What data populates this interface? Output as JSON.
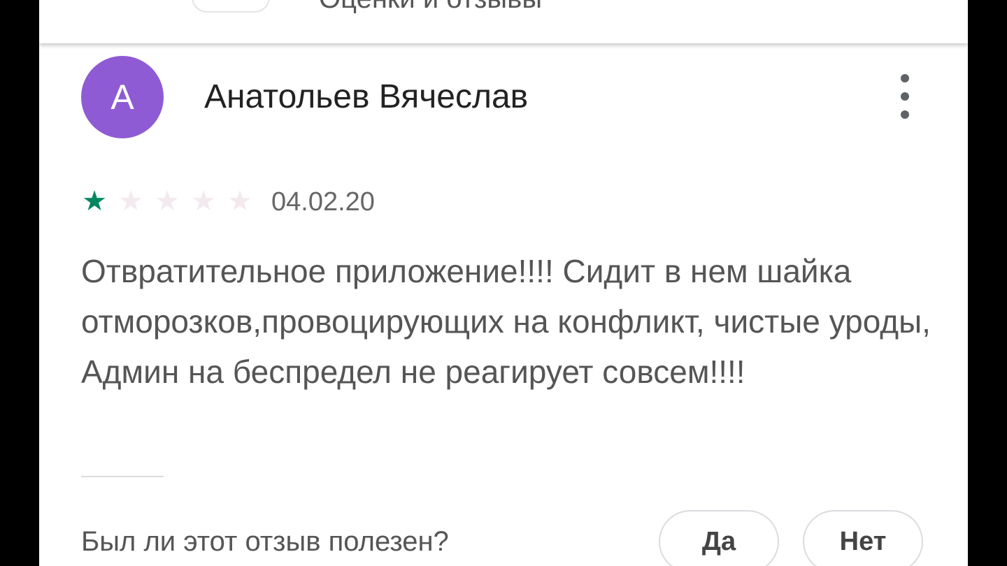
{
  "appbar": {
    "title": "Оценки и отзывы"
  },
  "review": {
    "avatar_letter": "A",
    "avatar_color": "#8e5bd4",
    "author": "Анатольев Вячеслав",
    "rating": 1,
    "rating_max": 5,
    "star_filled_color": "#01875f",
    "star_empty_color": "#f3e9ee",
    "date": "04.02.20",
    "text": "Отвратительное приложение!!!! Сидит в нем шайка отморозков,провоцирующих на конфликт, чистые уроды, Админ на беспредел не реагирует совсем!!!!"
  },
  "helpful": {
    "question": "Был ли этот отзыв полезен?",
    "yes_label": "Да",
    "no_label": "Нет"
  },
  "icons": {
    "more": "more-vert-icon",
    "star": "star-icon"
  }
}
